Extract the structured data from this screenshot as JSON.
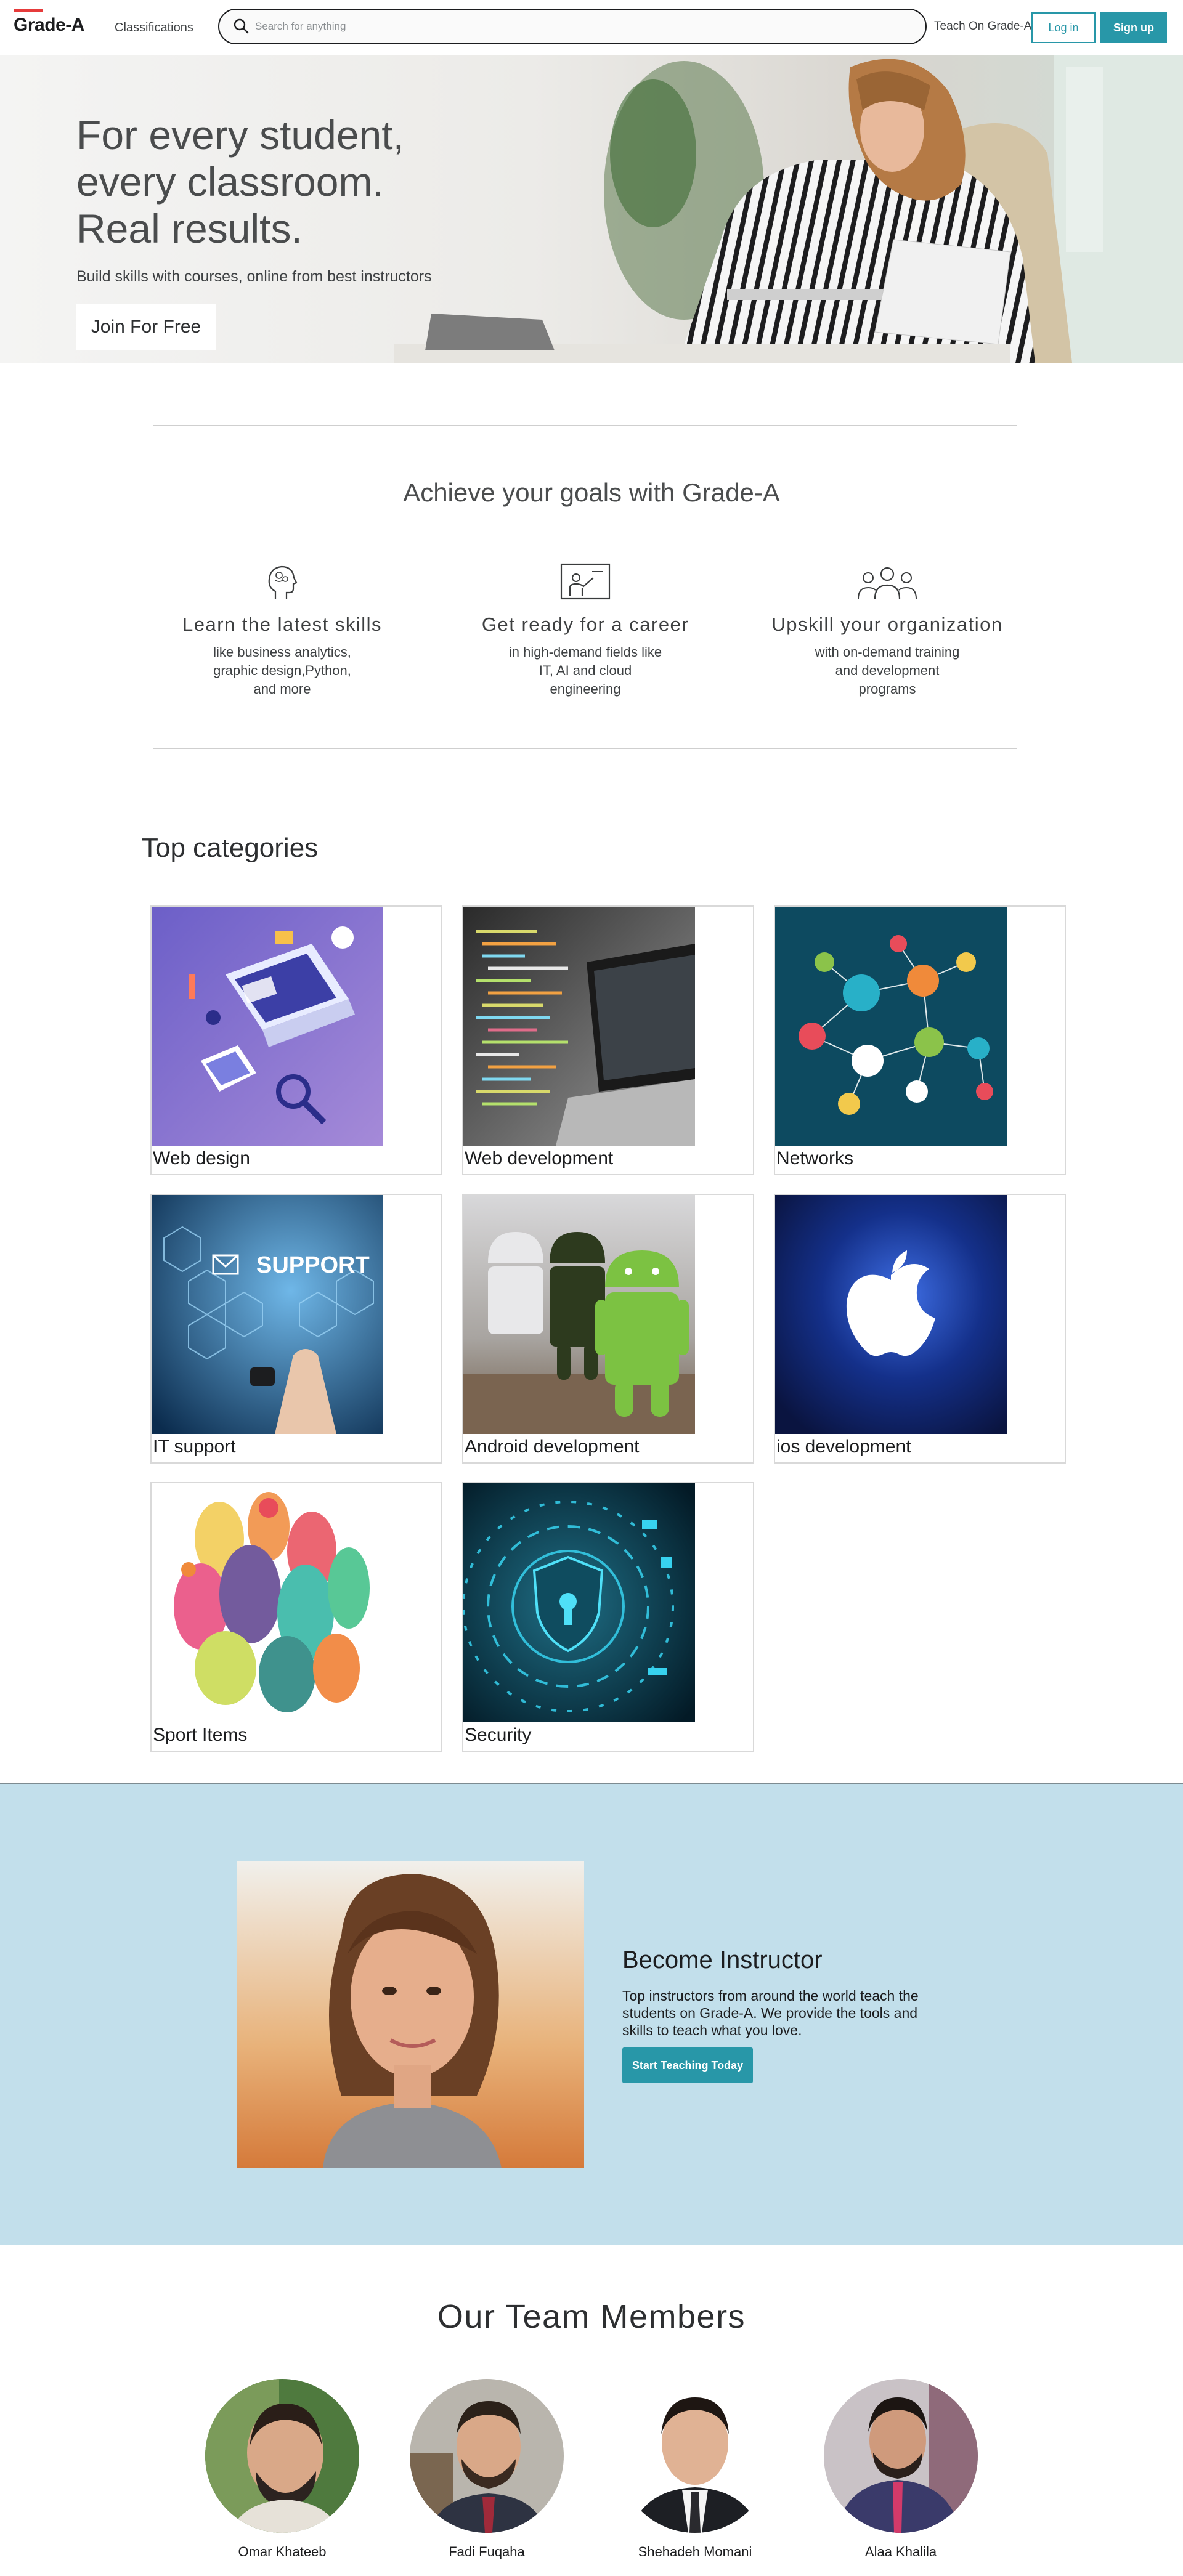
{
  "header": {
    "logo": "Grade-A",
    "classifications": "Classifications",
    "search_placeholder": "Search for anything",
    "teach": "Teach On Grade-A",
    "login": "Log in",
    "signup": "Sign up"
  },
  "hero": {
    "title_lines": [
      "For every student,",
      "every classroom.",
      "Real results."
    ],
    "subtitle": "Build skills with courses, online from best instructors",
    "cta": "Join For Free"
  },
  "goals": {
    "title": "Achieve your goals with Grade-A",
    "items": [
      {
        "icon": "brain-head-icon",
        "title": "Learn the latest skills",
        "desc": "like business analytics, graphic design,Python, and more"
      },
      {
        "icon": "presentation-board-icon",
        "title": "Get ready for a career",
        "desc": "in high-demand fields like IT, AI and cloud engineering"
      },
      {
        "icon": "team-group-icon",
        "title": "Upskill your organization",
        "desc": "with on-demand training and development programs"
      }
    ]
  },
  "categories": {
    "title": "Top categories",
    "items": [
      {
        "label": "Web design",
        "image": "web-design-illustration"
      },
      {
        "label": "Web development",
        "image": "code-laptop-photo"
      },
      {
        "label": "Networks",
        "image": "network-diagram-illustration"
      },
      {
        "label": "IT support",
        "image": "support-touchscreen-photo"
      },
      {
        "label": "Android development",
        "image": "android-figures-photo"
      },
      {
        "label": "ios development",
        "image": "apple-logo-photo"
      },
      {
        "label": "Sport Items",
        "image": "sport-players-illustration"
      },
      {
        "label": "Security",
        "image": "cyber-shield-illustration"
      }
    ]
  },
  "instructor": {
    "title": "Become Instructor",
    "desc": "Top instructors from around the world teach the students on Grade-A. We provide the tools and skills to teach what you love.",
    "cta": "Start Teaching Today"
  },
  "team": {
    "title": "Our Team Members",
    "members": [
      {
        "name": "Omar Khateeb"
      },
      {
        "name": "Fadi Fuqaha"
      },
      {
        "name": "Shehadeh Momani"
      },
      {
        "name": "Alaa Khalila"
      }
    ]
  },
  "colors": {
    "accent": "#2897a8",
    "logo_bar": "#e63b3b",
    "instructor_bg": "#c2dfeb"
  }
}
